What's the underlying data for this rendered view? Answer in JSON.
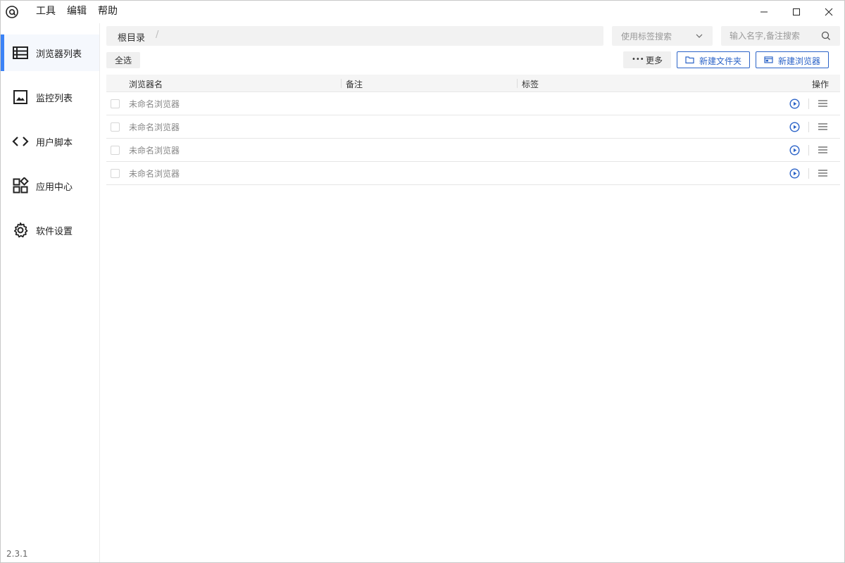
{
  "app": {
    "menu": [
      "工具",
      "编辑",
      "帮助"
    ],
    "version": "2.3.1",
    "accent_color": "#3b82f6",
    "primary_color": "#2b63c8"
  },
  "sidebar": {
    "items": [
      {
        "label": "浏览器列表",
        "icon": "table-list-icon",
        "active": true
      },
      {
        "label": "监控列表",
        "icon": "image-monitor-icon",
        "active": false
      },
      {
        "label": "用户脚本",
        "icon": "code-icon",
        "active": false
      },
      {
        "label": "应用中心",
        "icon": "apps-grid-icon",
        "active": false
      },
      {
        "label": "软件设置",
        "icon": "gear-icon",
        "active": false
      }
    ]
  },
  "toolbar": {
    "breadcrumb_root": "根目录",
    "breadcrumb_separator": "/",
    "tag_search_placeholder": "使用标签搜索",
    "name_search_placeholder": "输入名字,备注搜索",
    "select_all": "全选",
    "more": "更多",
    "new_folder": "新建文件夹",
    "new_browser": "新建浏览器"
  },
  "table": {
    "columns": [
      "浏览器名",
      "备注",
      "标签",
      "操作"
    ],
    "rows": [
      {
        "name": "未命名浏览器"
      },
      {
        "name": "未命名浏览器"
      },
      {
        "name": "未命名浏览器"
      },
      {
        "name": "未命名浏览器"
      }
    ]
  }
}
